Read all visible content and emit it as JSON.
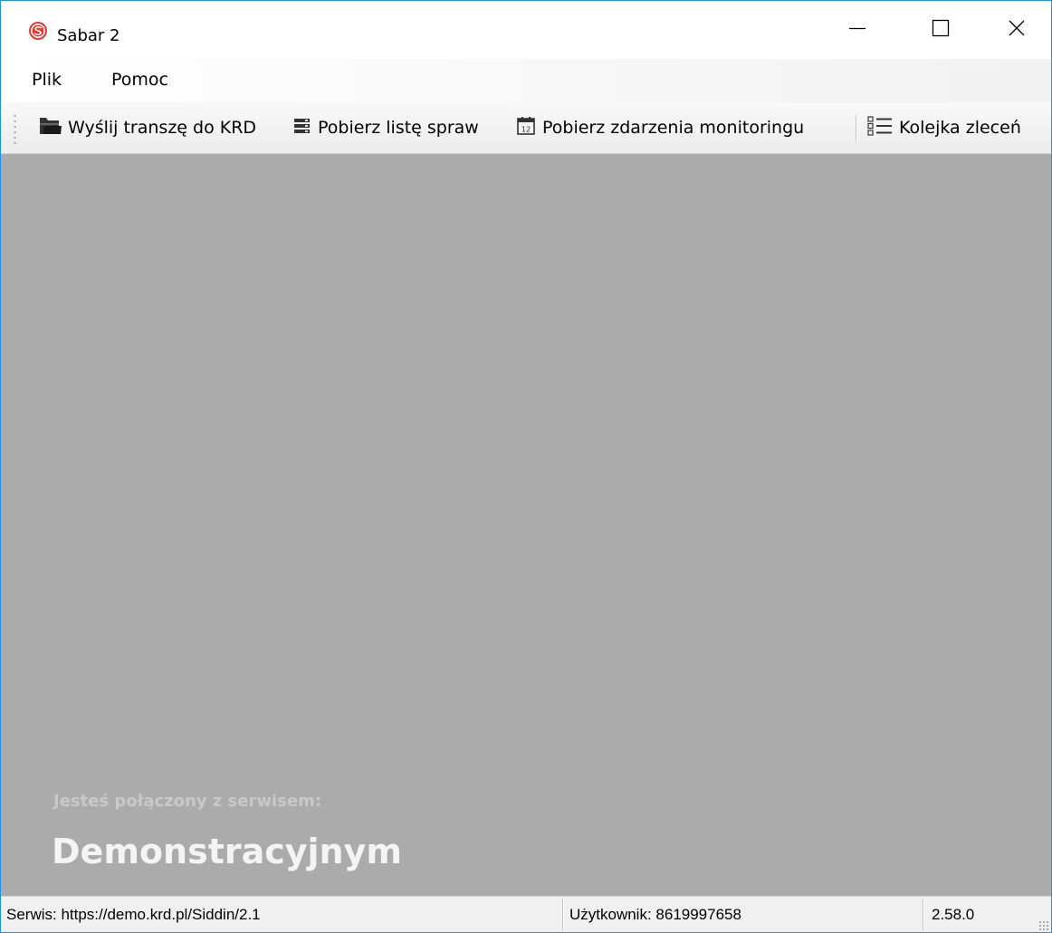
{
  "window": {
    "title": "Sabar 2",
    "accent": "#1f8fe8",
    "icon": "sabar-logo-icon"
  },
  "menu": {
    "items": [
      "Plik",
      "Pomoc"
    ]
  },
  "toolbar": {
    "buttons": [
      {
        "label": "Wyślij transzę do KRD",
        "icon": "folder-send-icon"
      },
      {
        "label": "Pobierz listę spraw",
        "icon": "server-list-icon"
      },
      {
        "label": "Pobierz zdarzenia monitoringu",
        "icon": "calendar-icon"
      },
      {
        "label": "Kolejka zleceń",
        "icon": "queue-list-icon"
      }
    ]
  },
  "main": {
    "connected_label": "Jesteś połączony z serwisem:",
    "service_name": "Demonstracyjnym",
    "background": "#ababab"
  },
  "statusbar": {
    "service": "Serwis: https://demo.krd.pl/Siddin/2.1",
    "user": "Użytkownik: 8619997658",
    "version": "2.58.0"
  }
}
